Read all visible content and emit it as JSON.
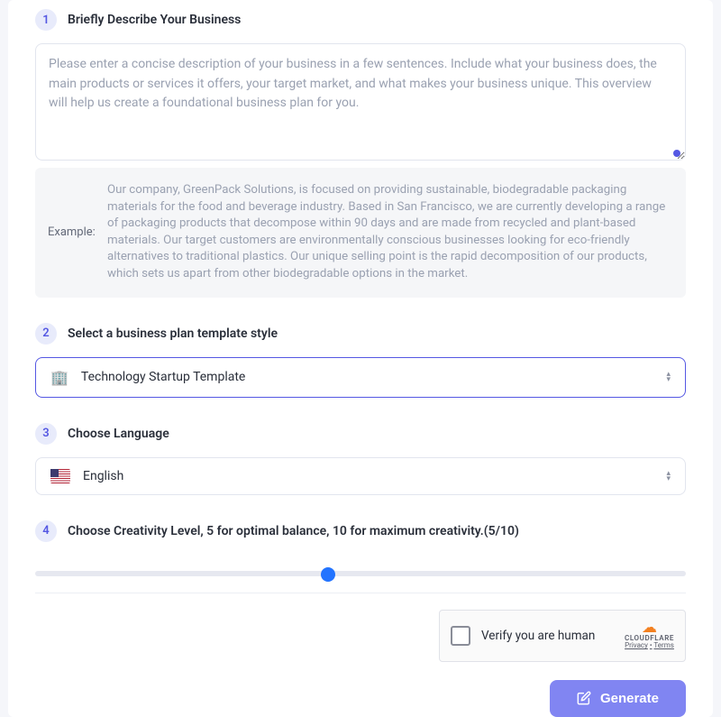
{
  "steps": {
    "s1": {
      "num": "1",
      "title": "Briefly Describe Your Business"
    },
    "s2": {
      "num": "2",
      "title": "Select a business plan template style"
    },
    "s3": {
      "num": "3",
      "title": "Choose Language"
    },
    "s4": {
      "num": "4",
      "title": "Choose Creativity Level, 5 for optimal balance, 10 for maximum creativity.(5/10)"
    }
  },
  "description": {
    "value": "",
    "placeholder": "Please enter a concise description of your business in a few sentences. Include what your business does, the main products or services it offers, your target market, and what makes your business unique. This overview will help us create a foundational business plan for you."
  },
  "example": {
    "label": "Example:",
    "text": "Our company, GreenPack Solutions, is focused on providing sustainable, biodegradable packaging materials for the food and beverage industry. Based in San Francisco, we are currently developing a range of packaging products that decompose within 90 days and are made from recycled and plant-based materials. Our target customers are environmentally conscious businesses looking for eco-friendly alternatives to traditional plastics. Our unique selling point is the rapid decomposition of our products, which sets us apart from other biodegradable options in the market."
  },
  "template_select": {
    "icon": "🏢",
    "selected": "Technology Startup Template"
  },
  "language_select": {
    "selected": "English",
    "flag": "us"
  },
  "creativity": {
    "value": 5,
    "min": 0,
    "max": 10
  },
  "captcha": {
    "label": "Verify you are human",
    "brand": "CLOUDFLARE",
    "privacy": "Privacy",
    "dot": "•",
    "terms": "Terms"
  },
  "generate_label": "Generate",
  "colors": {
    "accent": "#5558e3",
    "slider_thumb": "#2374ff",
    "cf_orange": "#f38020"
  }
}
